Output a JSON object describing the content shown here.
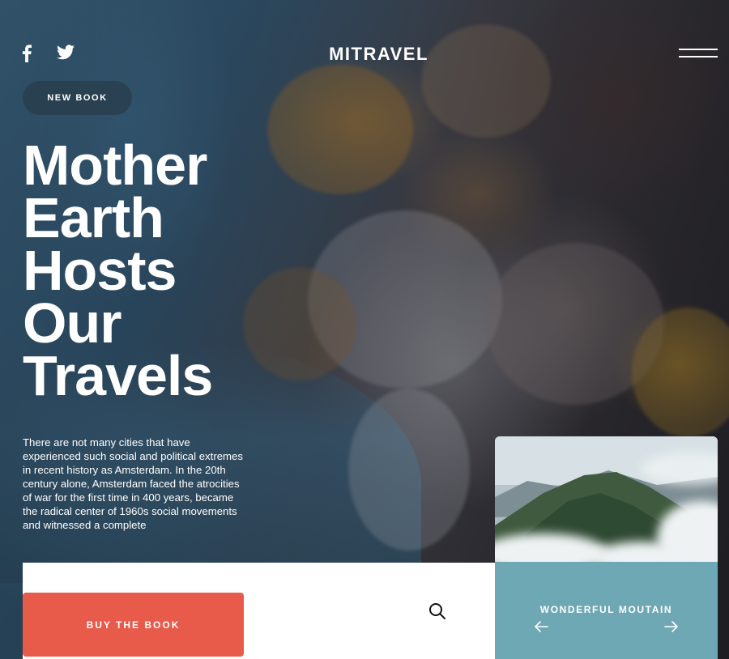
{
  "header": {
    "brand": "MITRAVEL",
    "social": [
      {
        "icon": "facebook-icon"
      },
      {
        "icon": "twitter-icon"
      }
    ],
    "menu_icon": "hamburger-menu-icon"
  },
  "badge": {
    "label": "NEW BOOK"
  },
  "hero": {
    "headline_lines": [
      "Mother",
      "Earth",
      "Hosts",
      "Our",
      "Travels"
    ],
    "description": "There are not many cities that have experienced such social and political extremes in recent history as Amsterdam. In the 20th century alone, Amsterdam faced the atrocities of war for the first time in 400 years, became the radical center of 1960s social movements and witnessed a complete"
  },
  "bottom_bar": {
    "buy_label": "BUY THE BOOK",
    "search_icon": "search-icon"
  },
  "card": {
    "title": "WONDERFUL MOUTAIN",
    "prev_icon": "arrow-left-icon",
    "next_icon": "arrow-right-icon"
  },
  "colors": {
    "buy_button": "#e85a4a",
    "card_panel": "#6fa8b5",
    "badge_bg": "#283e4e"
  }
}
